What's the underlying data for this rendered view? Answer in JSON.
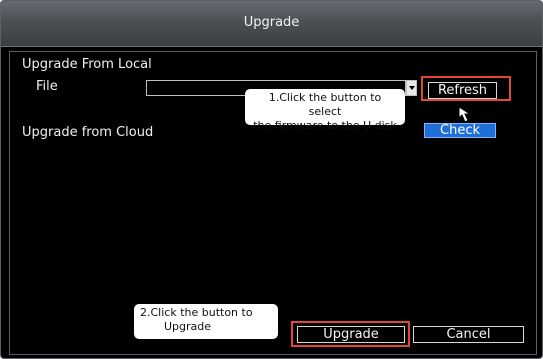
{
  "window": {
    "title": "Upgrade"
  },
  "local": {
    "section_label": "Upgrade From Local",
    "file_label": "File",
    "file_value": "",
    "refresh_label": "Refresh"
  },
  "cloud": {
    "section_label": "Upgrade from Cloud",
    "check_label": "Check"
  },
  "footer": {
    "upgrade_label": "Upgrade",
    "cancel_label": "Cancel"
  },
  "annotations": {
    "refresh_tip_line1": "1.Click the button to select",
    "refresh_tip_line2": "the firmware to the U disk",
    "upgrade_tip_line1": "2.Click the button to",
    "upgrade_tip_line2": "Upgrade"
  },
  "colors": {
    "highlight": "#e2473a",
    "check_button": "#1f6fd6",
    "background": "#000000"
  },
  "icons": {
    "cursor": "arrow-cursor-icon",
    "dropdown": "dropdown-arrow-icon"
  }
}
